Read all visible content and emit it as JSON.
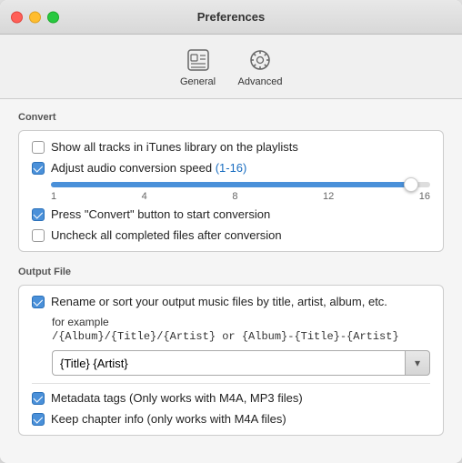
{
  "window": {
    "title": "Preferences",
    "controls": {
      "close": "close",
      "minimize": "minimize",
      "maximize": "maximize"
    }
  },
  "toolbar": {
    "items": [
      {
        "id": "general",
        "label": "General",
        "icon": "general-icon"
      },
      {
        "id": "advanced",
        "label": "Advanced",
        "icon": "advanced-icon"
      }
    ]
  },
  "sections": {
    "convert": {
      "title": "Convert",
      "checkboxes": [
        {
          "id": "show-tracks",
          "checked": false,
          "label": "Show all tracks in iTunes library on the playlists"
        },
        {
          "id": "adjust-speed",
          "checked": true,
          "label": "Adjust audio conversion speed (1-16)"
        },
        {
          "id": "press-convert",
          "checked": true,
          "label": "Press \"Convert\" button to start conversion"
        },
        {
          "id": "uncheck-completed",
          "checked": false,
          "label": "Uncheck all completed files after conversion"
        }
      ],
      "slider": {
        "min_label": "1",
        "labels": [
          "1",
          "4",
          "8",
          "12",
          "16"
        ],
        "value": 100,
        "fill_percent": 95
      }
    },
    "output_file": {
      "title": "Output File",
      "checkboxes": [
        {
          "id": "rename-sort",
          "checked": true,
          "label": "Rename or sort your output music files by title, artist, album, etc."
        },
        {
          "id": "metadata-tags",
          "checked": true,
          "label": "Metadata tags (Only works with M4A, MP3 files)"
        },
        {
          "id": "keep-chapter",
          "checked": true,
          "label": "Keep chapter info (only works with  M4A files)"
        }
      ],
      "example_label": "for example",
      "example_code": "/{Album}/{Title}/{Artist} or {Album}-{Title}-{Artist}",
      "input_value": "{Title} {Artist}",
      "input_placeholder": "{Title} {Artist}"
    }
  }
}
